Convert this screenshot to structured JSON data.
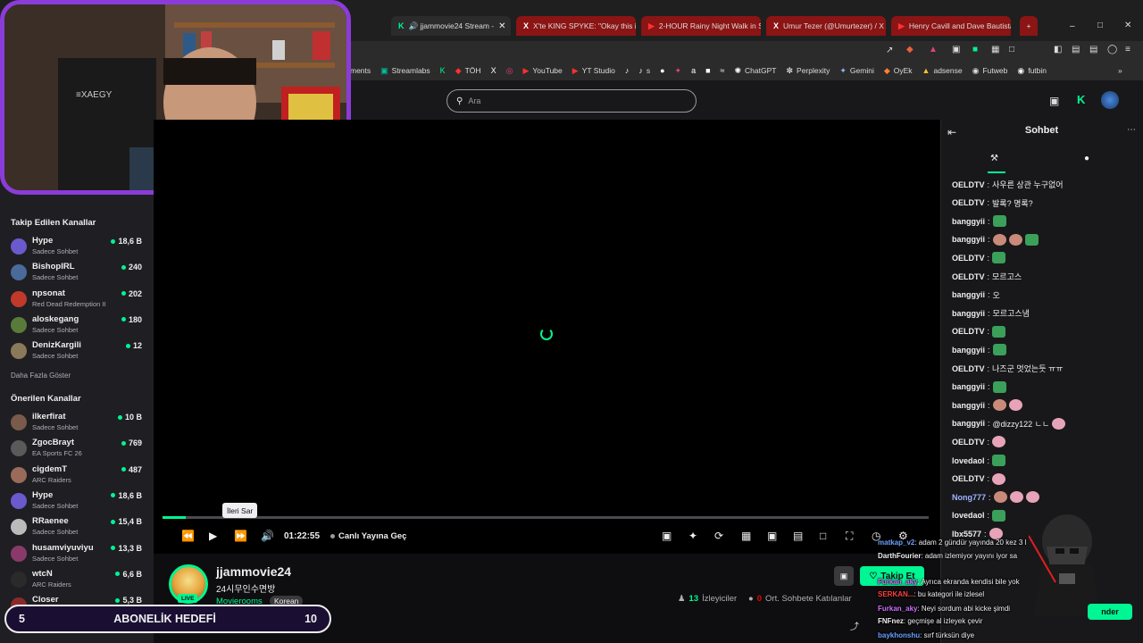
{
  "browser": {
    "tabs": [
      {
        "icon": "K",
        "title": "🔊 jjammovie24 Stream - ",
        "active": true
      },
      {
        "icon": "X",
        "title": "X'te KING SPYKE: \"Okay this is",
        "active": false
      },
      {
        "icon": "▶",
        "title": "2-HOUR Rainy Night Walk in S",
        "active": false
      },
      {
        "icon": "X",
        "title": "Umur Tezer (@Umurtezer) / X",
        "active": false
      },
      {
        "icon": "▶",
        "title": "Henry Cavill and Dave Bautista",
        "active": false
      }
    ],
    "new_tab": "+",
    "bookmarks": [
      {
        "icon": "",
        "label": "ments"
      },
      {
        "icon": "▣",
        "label": "Streamlabs"
      },
      {
        "icon": "K",
        "label": ""
      },
      {
        "icon": "◆",
        "label": "TÖH"
      },
      {
        "icon": "X",
        "label": ""
      },
      {
        "icon": "◎",
        "label": ""
      },
      {
        "icon": "▶",
        "label": "YouTube"
      },
      {
        "icon": "▶",
        "label": "YT Studio"
      },
      {
        "icon": "♪",
        "label": ""
      },
      {
        "icon": "♪",
        "label": "s"
      },
      {
        "icon": "●",
        "label": ""
      },
      {
        "icon": "✦",
        "label": ""
      },
      {
        "icon": "a",
        "label": ""
      },
      {
        "icon": "■",
        "label": ""
      },
      {
        "icon": "≈",
        "label": ""
      },
      {
        "icon": "✺",
        "label": "ChatGPT"
      },
      {
        "icon": "✼",
        "label": "Perplexity"
      },
      {
        "icon": "✦",
        "label": "Gemini"
      },
      {
        "icon": "◆",
        "label": "OyEk"
      },
      {
        "icon": "▲",
        "label": "adsense"
      },
      {
        "icon": "◉",
        "label": "Futweb"
      },
      {
        "icon": "◉",
        "label": "futbin"
      }
    ],
    "more_bookmarks": "»"
  },
  "search": {
    "placeholder": "Ara"
  },
  "sidebar": {
    "followed_title": "Takip Edilen Kanallar",
    "followed": [
      {
        "name": "Hype",
        "game": "Sadece Sohbet",
        "viewers": "18,6 B",
        "color": "#6a5acd"
      },
      {
        "name": "BishopIRL",
        "game": "Sadece Sohbet",
        "viewers": "240",
        "color": "#4a6a9a"
      },
      {
        "name": "npsonat",
        "game": "Red Dead Redemption II",
        "viewers": "202",
        "color": "#c0392b"
      },
      {
        "name": "aloskegang",
        "game": "Sadece Sohbet",
        "viewers": "180",
        "color": "#5a7a3a"
      },
      {
        "name": "DenizKargili",
        "game": "Sadece Sohbet",
        "viewers": "12",
        "color": "#8a7a5a"
      }
    ],
    "show_more": "Daha Fazla Göster",
    "recommended_title": "Önerilen Kanallar",
    "recommended": [
      {
        "name": "ilkerfirat",
        "game": "Sadece Sohbet",
        "viewers": "10 B",
        "color": "#7a5a4a"
      },
      {
        "name": "ZgocBrayt",
        "game": "EA Sports FC 26",
        "viewers": "769",
        "color": "#5a5a5a"
      },
      {
        "name": "cigdemT",
        "game": "ARC Raiders",
        "viewers": "487",
        "color": "#9a6a5a"
      },
      {
        "name": "Hype",
        "game": "Sadece Sohbet",
        "viewers": "18,6 B",
        "color": "#6a5acd"
      },
      {
        "name": "RRaenee",
        "game": "Sadece Sohbet",
        "viewers": "15,4 B",
        "color": "#bbbbbb"
      },
      {
        "name": "husamviyuviyu",
        "game": "Sadece Sohbet",
        "viewers": "13,3 B",
        "color": "#8a3a6a"
      },
      {
        "name": "wtcN",
        "game": "ARC Raiders",
        "viewers": "6,6 B",
        "color": "#2a2a2a"
      },
      {
        "name": "Closer",
        "game": "",
        "viewers": "5,3 B",
        "color": "#8a2a2a"
      }
    ]
  },
  "player": {
    "tooltip": "İleri Sar",
    "time": "01:22:55",
    "go_live": "Canlı Yayına Geç",
    "progress": 0.03
  },
  "stream": {
    "channel": "jjammovie24",
    "title": "24시무인수면방",
    "category": "Movierooms",
    "tag": "Korean",
    "live": "LIVE",
    "viewers_count": "13",
    "viewers_label": "İzleyiciler",
    "avg_count": "0",
    "avg_label": "Ort. Sohbete Katılanlar",
    "follow_label": "Takip Et"
  },
  "subgoal": {
    "current": "5",
    "label": "ABONELİK HEDEFİ",
    "target": "10"
  },
  "chat": {
    "title": "Sohbet",
    "messages": [
      {
        "user": "OELDTV",
        "color": "#efeff1",
        "text": "사우른 상관 누구없어",
        "emotes": []
      },
      {
        "user": "OELDTV",
        "color": "#efeff1",
        "text": "발록? 명록?",
        "emotes": []
      },
      {
        "user": "banggyii",
        "color": "#efeff1",
        "text": "",
        "emotes": [
          "frog"
        ]
      },
      {
        "user": "banggyii",
        "color": "#efeff1",
        "text": "",
        "emotes": [
          "face",
          "face",
          "frog"
        ]
      },
      {
        "user": "OELDTV",
        "color": "#efeff1",
        "text": "",
        "emotes": [
          "frog"
        ]
      },
      {
        "user": "OELDTV",
        "color": "#efeff1",
        "text": "모르고스",
        "emotes": []
      },
      {
        "user": "banggyii",
        "color": "#efeff1",
        "text": "오",
        "emotes": []
      },
      {
        "user": "banggyii",
        "color": "#efeff1",
        "text": "모르고스냄",
        "emotes": []
      },
      {
        "user": "OELDTV",
        "color": "#efeff1",
        "text": "",
        "emotes": [
          "frog"
        ]
      },
      {
        "user": "banggyii",
        "color": "#efeff1",
        "text": "",
        "emotes": [
          "frog"
        ]
      },
      {
        "user": "OELDTV",
        "color": "#efeff1",
        "text": "나즈군 멋었는듯 ㅠㅠ",
        "emotes": []
      },
      {
        "user": "banggyii",
        "color": "#efeff1",
        "text": "",
        "emotes": [
          "frog"
        ]
      },
      {
        "user": "banggyii",
        "color": "#efeff1",
        "text": "",
        "emotes": [
          "face",
          "pink"
        ]
      },
      {
        "user": "banggyii",
        "color": "#efeff1",
        "text": "@dizzy122 ㄴㄴ",
        "emotes": [
          "pink"
        ]
      },
      {
        "user": "OELDTV",
        "color": "#efeff1",
        "text": "",
        "emotes": [
          "pink"
        ]
      },
      {
        "user": "lovedaol",
        "color": "#efeff1",
        "text": "",
        "emotes": [
          "frog"
        ]
      },
      {
        "user": "OELDTV",
        "color": "#efeff1",
        "text": "",
        "emotes": [
          "pink"
        ]
      },
      {
        "user": "Nong777",
        "color": "#a0b4ff",
        "text": "",
        "emotes": [
          "face",
          "pink",
          "pink"
        ]
      },
      {
        "user": "lovedaol",
        "color": "#efeff1",
        "text": "",
        "emotes": [
          "frog"
        ]
      },
      {
        "user": "lbx5577",
        "color": "#efeff1",
        "text": "",
        "emotes": [
          "pink"
        ]
      }
    ],
    "send_label": "nder"
  },
  "overlay_alerts": [
    {
      "user": "matkap_v2",
      "text": ": adam 2 gündür yayında 20 kez 3 l",
      "color": "#6aa0ff"
    },
    {
      "user": "DarthFourier",
      "text": ": adam izlemiyor yayını iyor sa",
      "color": "#efeff1"
    },
    {
      "user": "Furkan_aky",
      "text": ": Ayrıca ekranda kendisi bile yok",
      "color": "#d070ff"
    },
    {
      "user": "SERKAN...",
      "text": ": bu kategori ile izlesel",
      "color": "#ff4040"
    },
    {
      "user": "Furkan_aky",
      "text": ": Neyi sordum abi kicke şimdi",
      "color": "#d070ff"
    },
    {
      "user": "FNFnez",
      "text": ": geçmişe al izleyek çevir",
      "color": "#efeff1"
    },
    {
      "user": "baykhonshu",
      "text": ": sırf türksün diye",
      "color": "#6aa0ff"
    }
  ]
}
